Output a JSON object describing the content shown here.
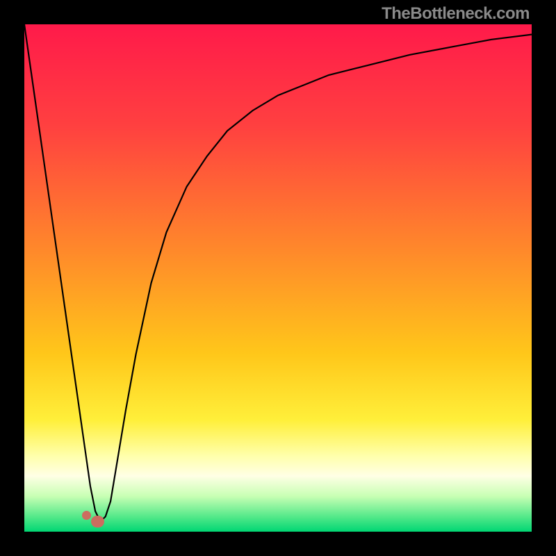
{
  "watermark": "TheBottleneck.com",
  "chart_data": {
    "type": "line",
    "title": "",
    "xlabel": "",
    "ylabel": "",
    "xlim": [
      0,
      100
    ],
    "ylim": [
      0,
      100
    ],
    "grid": false,
    "legend": false,
    "background_gradient": {
      "stops": [
        {
          "offset": 0.0,
          "color": "#ff1a4a"
        },
        {
          "offset": 0.2,
          "color": "#ff4040"
        },
        {
          "offset": 0.45,
          "color": "#ff8a2a"
        },
        {
          "offset": 0.65,
          "color": "#ffc71a"
        },
        {
          "offset": 0.78,
          "color": "#ffef3a"
        },
        {
          "offset": 0.85,
          "color": "#ffffaa"
        },
        {
          "offset": 0.89,
          "color": "#ffffe5"
        },
        {
          "offset": 0.93,
          "color": "#c8ffb4"
        },
        {
          "offset": 0.97,
          "color": "#55e98a"
        },
        {
          "offset": 1.0,
          "color": "#00d673"
        }
      ]
    },
    "series": [
      {
        "name": "bottleneck-curve",
        "color": "#000000",
        "type": "line",
        "x": [
          0,
          2,
          4,
          6,
          8,
          10,
          12,
          13,
          14,
          15,
          16,
          17,
          18,
          20,
          22,
          25,
          28,
          32,
          36,
          40,
          45,
          50,
          55,
          60,
          68,
          76,
          84,
          92,
          100
        ],
        "y": [
          100,
          86,
          72,
          58,
          44,
          30,
          16,
          9,
          4,
          2,
          3,
          6,
          12,
          24,
          35,
          49,
          59,
          68,
          74,
          79,
          83,
          86,
          88,
          90,
          92,
          94,
          95.5,
          97,
          98
        ]
      }
    ],
    "markers": [
      {
        "name": "highlight-segment",
        "color": "#cc6d5f",
        "shape": "capsule",
        "x_range": [
          13.2,
          15.8
        ],
        "y": 2,
        "thickness_pct": 2.4
      },
      {
        "name": "highlight-dot",
        "color": "#cc6d5f",
        "shape": "circle",
        "x": 12.3,
        "y": 3.2,
        "radius_pct": 0.9
      }
    ]
  }
}
